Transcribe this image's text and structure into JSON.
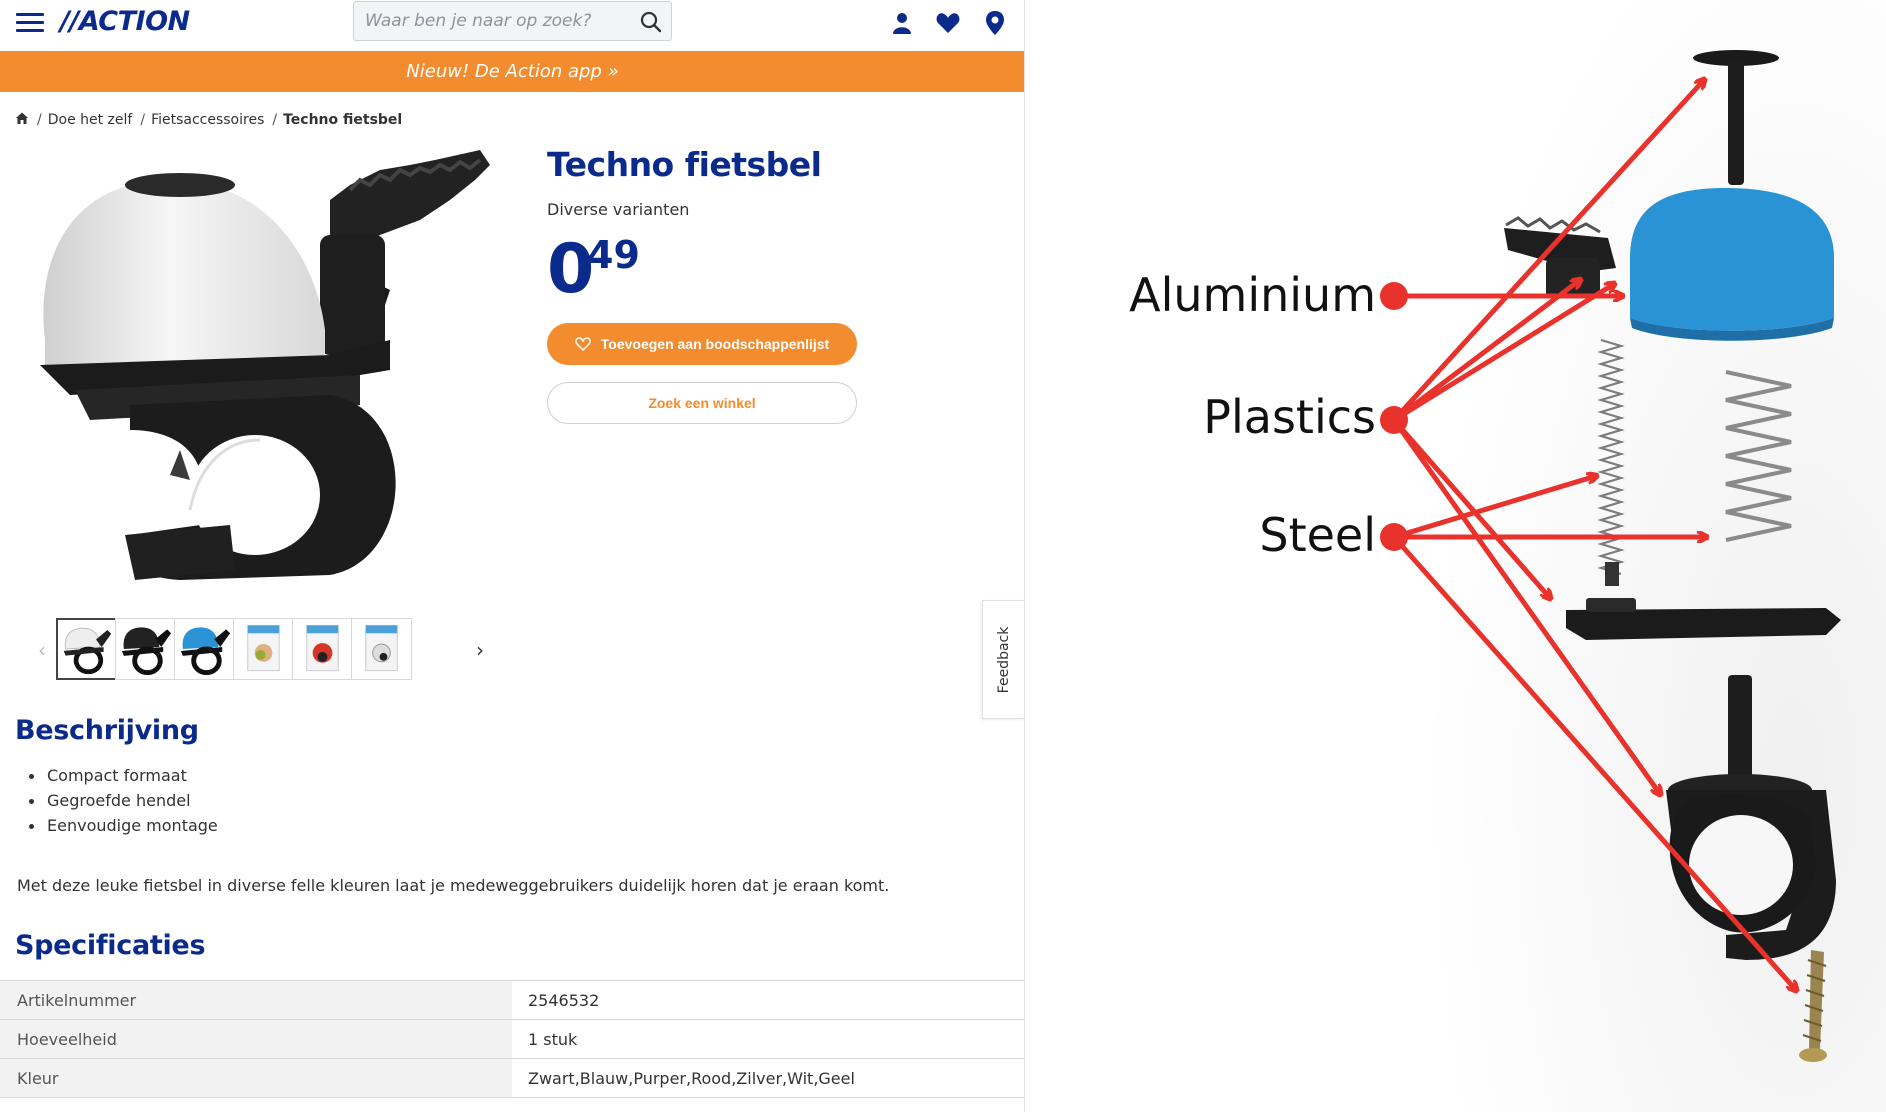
{
  "header": {
    "logo_text": "//ACTION",
    "search": {
      "placeholder": "Waar ben je naar op zoek?"
    },
    "icons": [
      "menu-icon",
      "search-icon",
      "account-icon",
      "heart-icon",
      "location-pin-icon"
    ]
  },
  "promo": {
    "text": "Nieuw! De Action app »"
  },
  "breadcrumb": {
    "items": [
      "Doe het zelf",
      "Fietsaccessoires"
    ],
    "current": "Techno fietsbel"
  },
  "product": {
    "title": "Techno fietsbel",
    "subtitle": "Diverse varianten",
    "price_int": "0",
    "price_dec": "49",
    "add_to_list_label": "Toevoegen aan boodschappenlijst",
    "find_store_label": "Zoek een winkel",
    "thumbnail_count": 6,
    "active_thumbnail": 1
  },
  "feedback": {
    "label": "Feedback"
  },
  "description": {
    "heading": "Beschrijving",
    "bullets": [
      "Compact formaat",
      "Gegroefde hendel",
      "Eenvoudige montage"
    ],
    "text": "Met deze leuke fietsbel in diverse felle kleuren laat je medeweggebruikers duidelijk horen dat je eraan komt."
  },
  "specs": {
    "heading": "Specificaties",
    "rows": [
      {
        "key": "Artikelnummer",
        "value": "2546532"
      },
      {
        "key": "Hoeveelheid",
        "value": "1 stuk"
      },
      {
        "key": "Kleur",
        "value": "Zwart,Blauw,Purper,Rood,Zilver,Wit,Geel"
      }
    ]
  },
  "diagram": {
    "labels": {
      "aluminium": "Aluminium",
      "plastics": "Plastics",
      "steel": "Steel"
    },
    "arrow_color": "#e8322b"
  },
  "colors": {
    "brand_blue": "#0a2a8c",
    "accent_orange": "#f28c2e",
    "bell_blue": "#2a93d5"
  }
}
